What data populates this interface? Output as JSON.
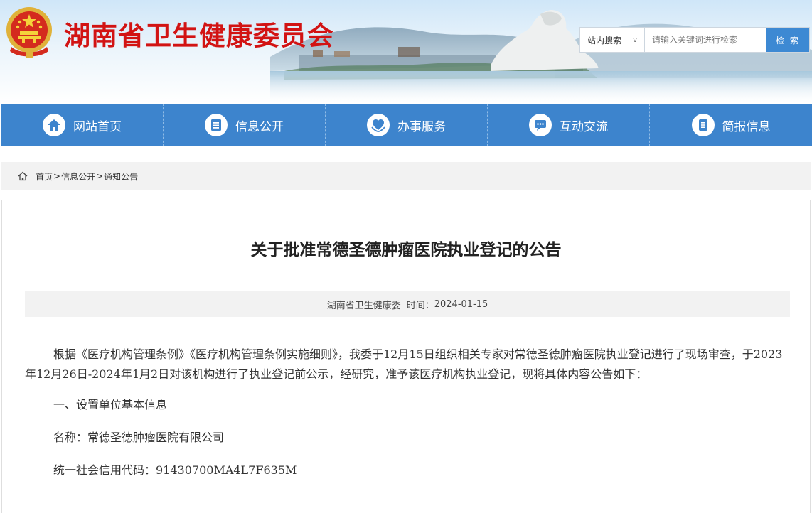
{
  "header": {
    "site_title": "湖南省卫生健康委员会",
    "emblem_icon": "national-emblem-icon",
    "search": {
      "scope_label": "站内搜索",
      "scope_chevron": "v",
      "placeholder": "请输入关键词进行检索",
      "button_label": "检 索"
    }
  },
  "nav": {
    "items": [
      {
        "label": "网站首页",
        "icon": "home-icon"
      },
      {
        "label": "信息公开",
        "icon": "document-list-icon"
      },
      {
        "label": "办事服务",
        "icon": "service-heart-icon"
      },
      {
        "label": "互动交流",
        "icon": "chat-icon"
      },
      {
        "label": "简报信息",
        "icon": "briefing-icon"
      }
    ]
  },
  "breadcrumb": {
    "icon": "home-outline-icon",
    "items": [
      "首页",
      "信息公开",
      "通知公告"
    ],
    "separator": ">"
  },
  "article": {
    "title": "关于批准常德圣德肿瘤医院执业登记的公告",
    "source": "湖南省卫生健康委",
    "time_label": "时间：",
    "date": "2024-01-15",
    "paragraphs": {
      "intro": "根据《医疗机构管理条例》《医疗机构管理条例实施细则》，我委于12月15日组织相关专家对常德圣德肿瘤医院执业登记进行了现场审查，于2023年12月26日-2024年1月2日对该机构进行了执业登记前公示，经研究，准予该医疗机构执业登记，现将具体内容公告如下：",
      "section1": "一、设置单位基本信息",
      "name": "名称：常德圣德肿瘤医院有限公司",
      "credit_code": "统一社会信用代码：91430700MA4L7F635M"
    }
  },
  "colors": {
    "title_red": "#d21313",
    "nav_blue": "#3d84cd",
    "search_button_blue": "#3d89d3",
    "breadcrumb_bg": "#f2f2f2"
  }
}
